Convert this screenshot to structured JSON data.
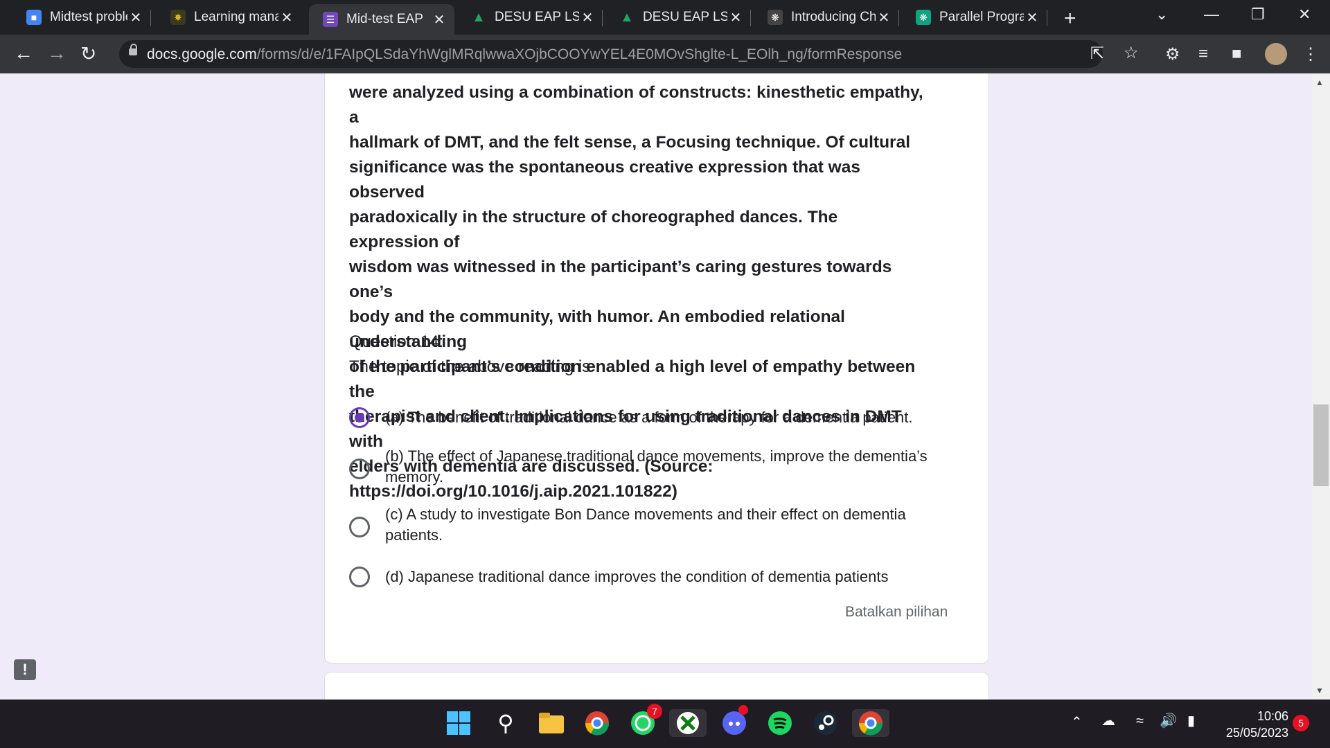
{
  "browser": {
    "tabs": [
      {
        "title": "Midtest proble",
        "icon": "person-icon",
        "color": "#4285f4"
      },
      {
        "title": "Learning mana",
        "icon": "emblem-icon",
        "color": "#d9b32b"
      },
      {
        "title": "Mid-test EAP",
        "icon": "forms-icon",
        "color": "#7248b9",
        "active": true
      },
      {
        "title": "DESU EAP LS M",
        "icon": "drive-icon",
        "color": "#1fa463"
      },
      {
        "title": "DESU EAP LS M",
        "icon": "drive-icon",
        "color": "#1fa463"
      },
      {
        "title": "Introducing Ch",
        "icon": "openai-icon",
        "color": "#6b6b6b"
      },
      {
        "title": "Parallel Prograi",
        "icon": "openai-icon",
        "color": "#10a37f"
      }
    ],
    "url_host": "docs.google.com",
    "url_path": "/forms/d/e/1FAIpQLSdaYhWglMRqlwwaXOjbCOOYwYEL4E0MOvShglte-L_EOlh_ng/formResponse"
  },
  "form": {
    "passage_lines": [
      "were analyzed using a combination of constructs: kinesthetic empathy, a",
      "hallmark of DMT, and the felt sense, a Focusing technique. Of cultural",
      "significance was the spontaneous creative expression that was observed",
      "paradoxically in the structure of choreographed dances. The expression of",
      "wisdom was witnessed in the participant’s caring gestures towards one’s",
      "body and the community, with humor. An embodied relational understanding",
      "of the participant’s condition enabled a high level of empathy between the",
      "therapist and client. Implications for using traditional dances in DMT with",
      "elders with dementia are discussed. (Source:",
      "https://doi.org/10.1016/j.aip.2021.101822)"
    ],
    "question_number": "Question 14:",
    "question_text": "The topic of the above reading is",
    "options": [
      {
        "label": "(a) The benefit of traditional dance as a form of therapy for a dementia patient.",
        "selected": true
      },
      {
        "label": "(b) The effect of Japanese traditional dance movements, improve the dementia’s memory.",
        "selected": false
      },
      {
        "label": "(c) A study to investigate Bon Dance movements and their effect on dementia patients.",
        "selected": false
      },
      {
        "label": "(d) Japanese traditional dance improves the condition of dementia patients",
        "selected": false
      }
    ],
    "clear_selection": "Batalkan pilihan"
  },
  "taskbar": {
    "whatsapp_badge": "7",
    "time": "10:06",
    "date": "25/05/2023",
    "notifications": "5"
  }
}
